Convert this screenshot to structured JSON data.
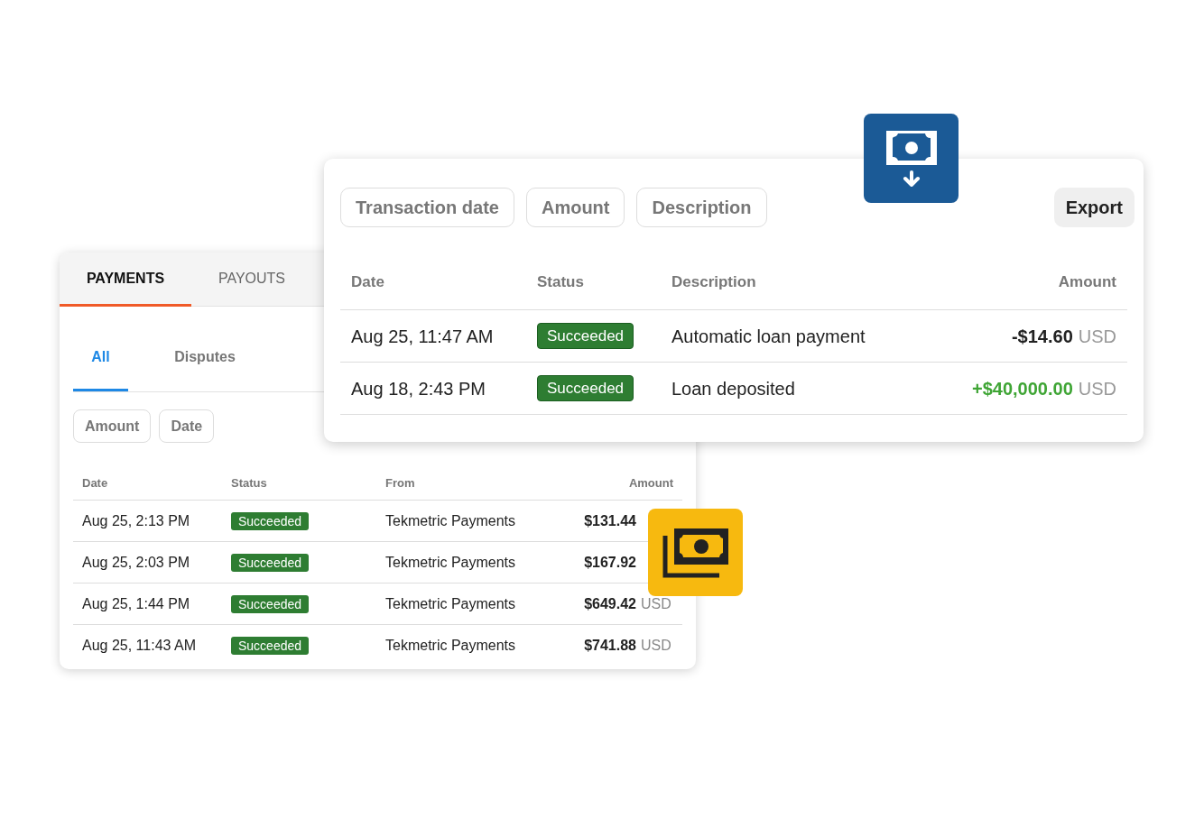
{
  "payments_card": {
    "tabs": [
      {
        "label": "PAYMENTS",
        "selected": true
      },
      {
        "label": "PAYOUTS",
        "selected": false
      }
    ],
    "subtabs": [
      {
        "label": "All",
        "selected": true
      },
      {
        "label": "Disputes",
        "selected": false
      }
    ],
    "filters": [
      "Amount",
      "Date"
    ],
    "columns": [
      "Date",
      "Status",
      "From",
      "Amount"
    ],
    "rows": [
      {
        "date": "Aug 25, 2:13 PM",
        "status": "Succeeded",
        "from": "Tekmetric Payments",
        "amount": "$131.44"
      },
      {
        "date": "Aug 25, 2:03 PM",
        "status": "Succeeded",
        "from": "Tekmetric Payments",
        "amount": "$167.92"
      },
      {
        "date": "Aug 25, 1:44 PM",
        "status": "Succeeded",
        "from": "Tekmetric Payments",
        "amount": "$649.42",
        "currency": "USD"
      },
      {
        "date": "Aug 25, 11:43 AM",
        "status": "Succeeded",
        "from": "Tekmetric Payments",
        "amount": "$741.88",
        "currency": "USD"
      }
    ]
  },
  "transactions_card": {
    "filters": [
      "Transaction date",
      "Amount",
      "Description"
    ],
    "export_button": "Export",
    "columns": [
      "Date",
      "Status",
      "Description",
      "Amount"
    ],
    "rows": [
      {
        "date": "Aug 25, 11:47 AM",
        "status": "Succeeded",
        "description": "Automatic loan payment",
        "amount": "-$14.60",
        "currency": "USD",
        "kind": "debit"
      },
      {
        "date": "Aug 18, 2:43 PM",
        "status": "Succeeded",
        "description": "Loan deposited",
        "amount": "+$40,000.00",
        "currency": "USD",
        "kind": "credit"
      }
    ]
  }
}
